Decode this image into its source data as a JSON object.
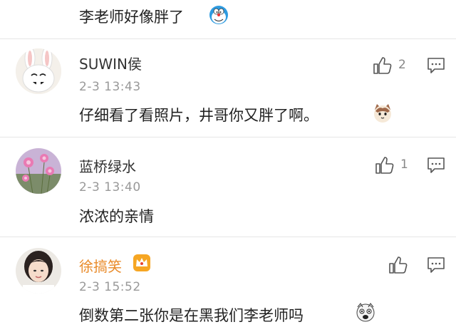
{
  "top_comment": {
    "text": "李老师好像胖了",
    "emoji": "doraemon-emoji"
  },
  "comments": [
    {
      "username": "SUWIN侯",
      "time": "2-3 13:43",
      "text": "仔细看了看照片，井哥你又胖了啊。",
      "emoji": "cat-face-emoji",
      "likes": "2",
      "avatar": "rabbit-avatar"
    },
    {
      "username": "蓝桥绿水",
      "time": "2-3 13:40",
      "text": "浓浓的亲情",
      "likes": "1",
      "avatar": "flowers-avatar"
    },
    {
      "username": "徐搞笑",
      "time": "2-3 15:52",
      "text": "倒数第二张你是在黑我们李老师吗",
      "emoji": "crazy-face-emoji",
      "likes": "",
      "avatar": "girl-avatar",
      "badge": "crown-icon"
    }
  ],
  "colors": {
    "vip_name": "#e98b2a",
    "time": "#999999",
    "text": "#222222",
    "icon": "#555555"
  }
}
